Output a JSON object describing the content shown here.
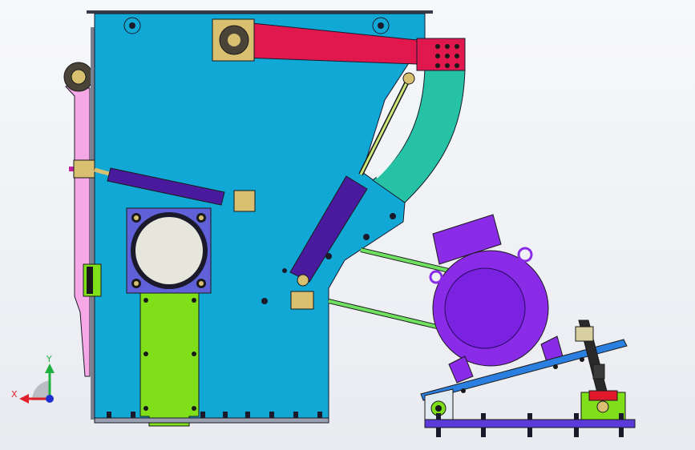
{
  "triad": {
    "x_label": "X",
    "y_label": "Y",
    "x_color": "#e0202a",
    "y_color": "#20b040",
    "z_color": "#2030d0"
  },
  "colors": {
    "frame": "#12a8d6",
    "cylinder_bar": "#e0184e",
    "curved_plate": "#25c2a6",
    "side_plate": "#f5a7e6",
    "green_plate": "#7fe01a",
    "motor": "#8a2be8",
    "motor_cover": "#8a2be8",
    "tilt_beam": "#2a7fe0",
    "base_rail": "#5a3ad8",
    "actuator": "#4a1a9e",
    "hardware": "#d8c070",
    "bearing_plate": "#6060d8",
    "bearing_disc": "#e6e6dc"
  }
}
